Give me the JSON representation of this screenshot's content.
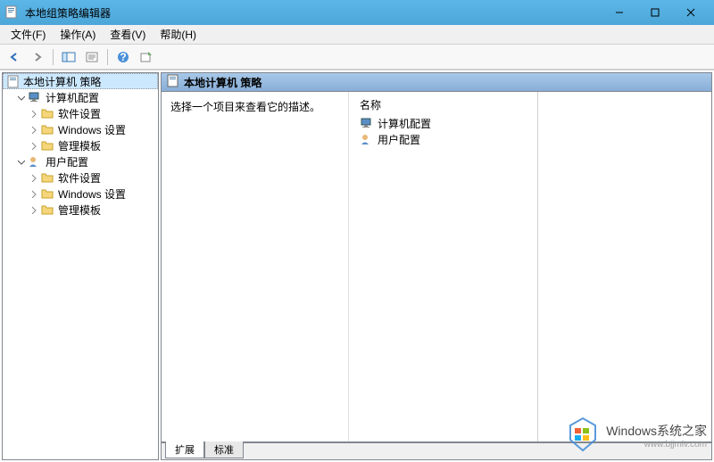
{
  "titlebar": {
    "title": "本地组策略编辑器"
  },
  "menu": {
    "file": "文件(F)",
    "action": "操作(A)",
    "view": "查看(V)",
    "help": "帮助(H)"
  },
  "tree": {
    "root": "本地计算机 策略",
    "computer_config": "计算机配置",
    "computer_software": "软件设置",
    "computer_windows": "Windows 设置",
    "computer_admin": "管理模板",
    "user_config": "用户配置",
    "user_software": "软件设置",
    "user_windows": "Windows 设置",
    "user_admin": "管理模板"
  },
  "right": {
    "header": "本地计算机 策略",
    "description": "选择一个项目来查看它的描述。",
    "name_header": "名称",
    "items": {
      "computer": "计算机配置",
      "user": "用户配置"
    }
  },
  "tabs": {
    "extended": "扩展",
    "standard": "标准"
  },
  "watermark": {
    "title": "Windows系统之家",
    "url": "www.bjjmlv.com"
  }
}
